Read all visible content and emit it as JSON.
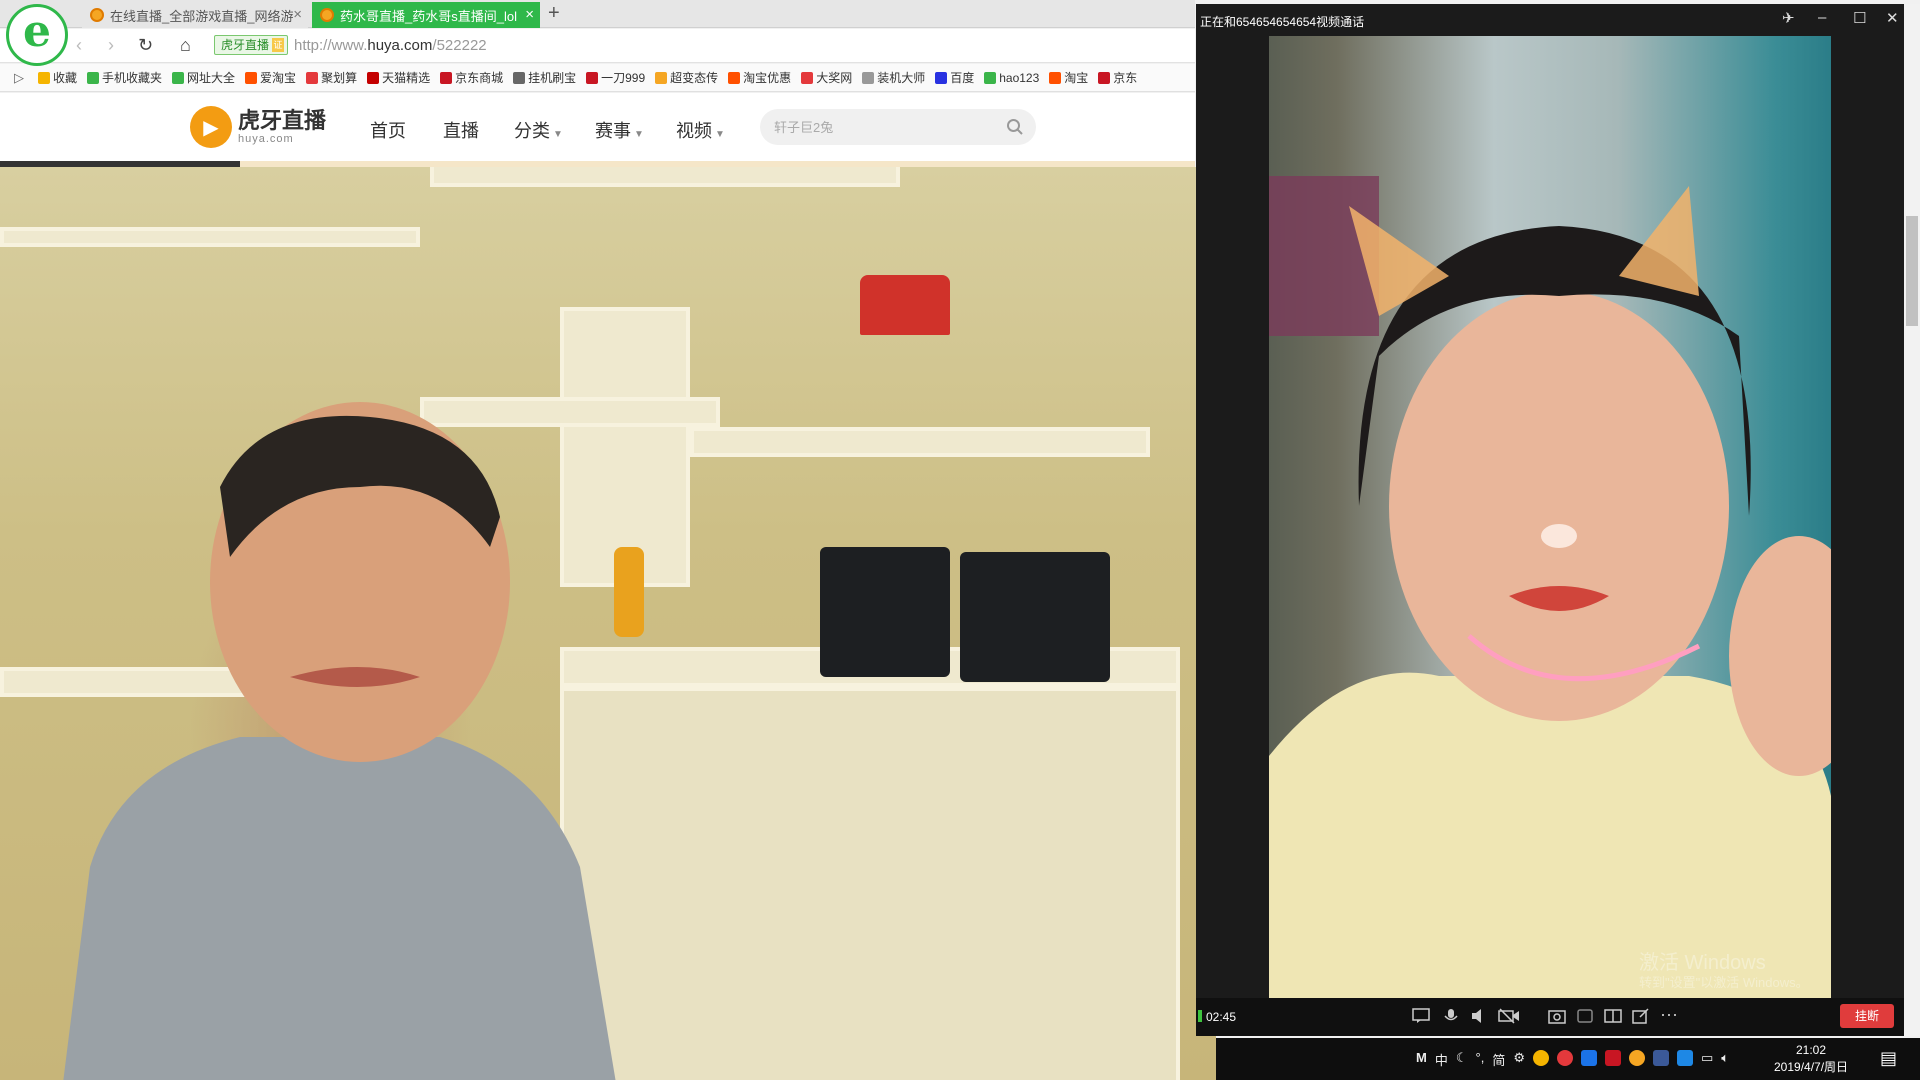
{
  "browser": {
    "tabs": [
      {
        "title": "在线直播_全部游戏直播_网络游",
        "active": false
      },
      {
        "title": "药水哥直播_药水哥s直播间_lol",
        "active": true
      }
    ],
    "new_tab_label": "+",
    "site_badge": "虎牙直播",
    "url_prefix": "http://www.",
    "url_host": "huya.com",
    "url_path": "/522222",
    "favorites": [
      {
        "label": "收藏",
        "color": "#f5b400"
      },
      {
        "label": "手机收藏夹",
        "color": "#3bb54a"
      },
      {
        "label": "网址大全",
        "color": "#3bb54a"
      },
      {
        "label": "爱淘宝",
        "color": "#ff5000"
      },
      {
        "label": "聚划算",
        "color": "#e4393c"
      },
      {
        "label": "天猫精选",
        "color": "#c40000"
      },
      {
        "label": "京东商城",
        "color": "#c81623"
      },
      {
        "label": "挂机刷宝",
        "color": "#666666"
      },
      {
        "label": "一刀999",
        "color": "#c81623"
      },
      {
        "label": "超变态传",
        "color": "#f5a623"
      },
      {
        "label": "淘宝优惠",
        "color": "#ff5000"
      },
      {
        "label": "大奖网",
        "color": "#e4393c"
      },
      {
        "label": "装机大师",
        "color": "#999999"
      },
      {
        "label": "百度",
        "color": "#2932e1"
      },
      {
        "label": "hao123",
        "color": "#3bb54a"
      },
      {
        "label": "淘宝",
        "color": "#ff5000"
      },
      {
        "label": "京东",
        "color": "#c81623"
      }
    ]
  },
  "site": {
    "logo_cn": "虎牙直播",
    "logo_en": "huya.com",
    "nav": [
      {
        "label": "首页",
        "dropdown": false
      },
      {
        "label": "直播",
        "dropdown": false
      },
      {
        "label": "分类",
        "dropdown": true
      },
      {
        "label": "赛事",
        "dropdown": true
      },
      {
        "label": "视频",
        "dropdown": true
      }
    ],
    "search_placeholder": "轩子巨2兔"
  },
  "call": {
    "title": "正在和654654654654视频通话",
    "timer": "02:45",
    "hangup_label": "挂断",
    "watermark": "激活 Windows",
    "watermark_sub": "转到\"设置\"以激活 Windows。"
  },
  "taskbar": {
    "tray_labels": [
      "M",
      "中",
      "简"
    ],
    "time": "21:02",
    "date": "2019/4/7/周日"
  },
  "colors": {
    "accent_green": "#2fb84a",
    "hangup_red": "#e03c3c",
    "huya_orange": "#f39c12"
  }
}
